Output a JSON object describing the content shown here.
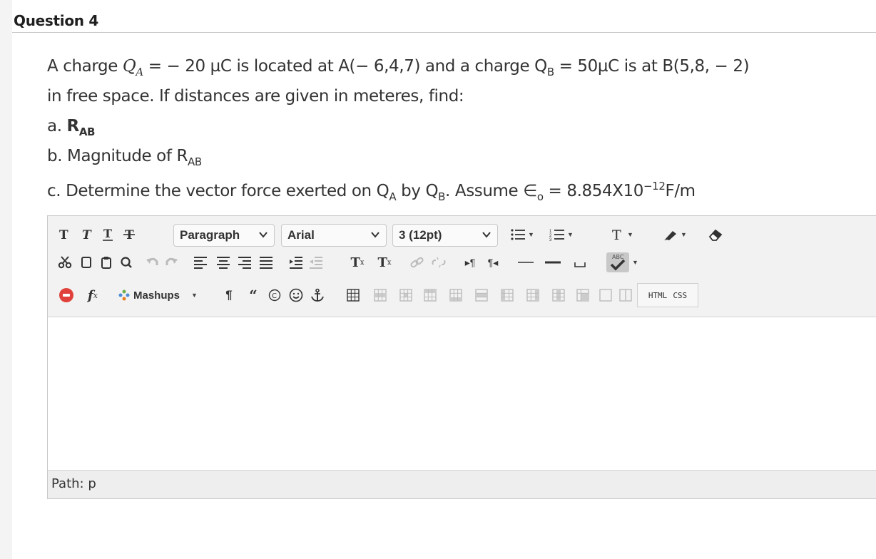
{
  "question": {
    "title": "Question 4",
    "line1": {
      "t1": "A charge ",
      "qa": "Q",
      "qa_sub": "A",
      "t2": " =  − 20 µC is located at A(− 6,4,7) and a charge Q",
      "qb_sub": "B",
      "t3": " = 50µC is at B(5,8, − 2)"
    },
    "line2": "in free space. If distances are given in meteres, find:",
    "line_a": {
      "prefix": "a. ",
      "r": "R",
      "sub": "AB"
    },
    "line_b": {
      "prefix": "b. Magnitude of R",
      "sub": "AB"
    },
    "line_c": {
      "t1": "c. Determine the vector force exerted on Q",
      "sub1": "A",
      "t2": " by Q",
      "sub2": "B",
      "t3": ". Assume ∈",
      "sub3": "o",
      "t4": " = 8.854X10",
      "sup": "−12",
      "t5": "F/m"
    }
  },
  "editor": {
    "toolbar": {
      "format_dropdown": "Paragraph",
      "font_dropdown": "Arial",
      "size_dropdown": "3 (12pt)",
      "mashups_label": "Mashups",
      "html_label": "HTML",
      "css_label": "CSS",
      "spell_label": "ABC",
      "fx_label": "f",
      "fx_sub": "x",
      "superscript_label": "T",
      "subscript_label": "T"
    },
    "path": {
      "label": "Path:",
      "value": "p"
    }
  },
  "colors": {
    "toolbar_bg": "#f2f2f2",
    "path_bg": "#eeeeee",
    "record_red": "#e0413a"
  }
}
